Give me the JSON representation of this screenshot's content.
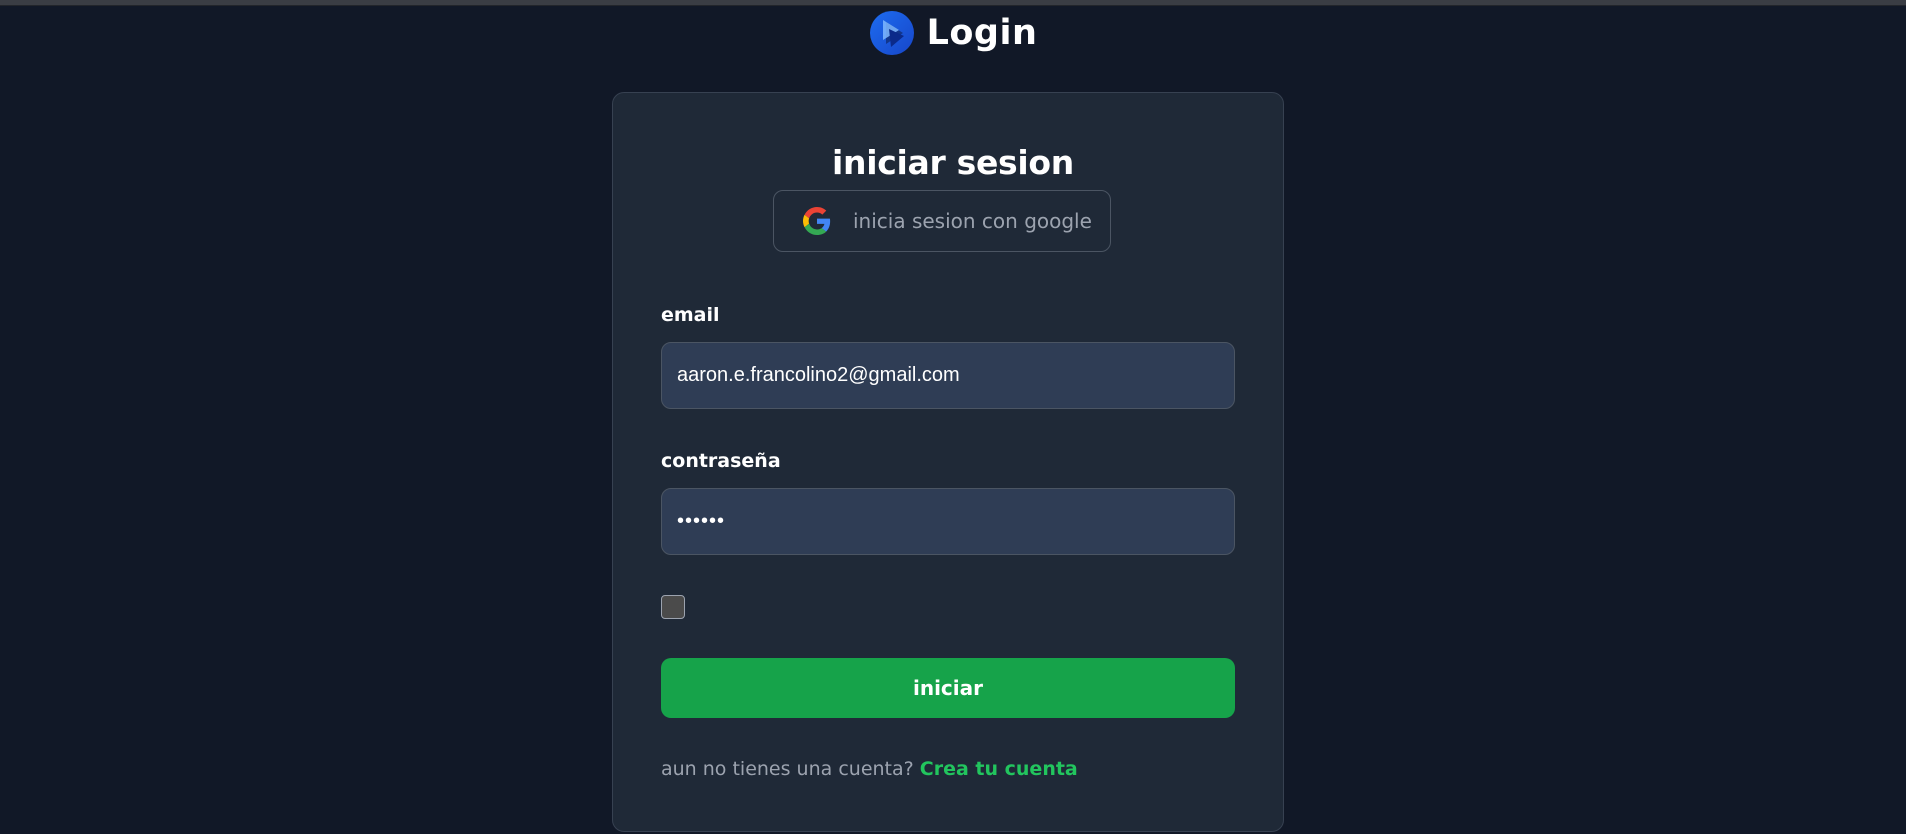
{
  "header": {
    "title": "Login",
    "logo_icon": "play-logo-icon"
  },
  "form": {
    "title": "iniciar sesion",
    "google_button_label": "inicia sesion con google",
    "google_icon": "google-g-icon",
    "email_label": "email",
    "email_value": "aaron.e.francolino2@gmail.com",
    "password_label": "contraseña",
    "password_value": "••••••",
    "remember_checked": false,
    "submit_label": "iniciar",
    "signup_prompt": "aun no tienes una cuenta?",
    "signup_link": "Crea tu cuenta"
  },
  "colors": {
    "background": "#111827",
    "card": "#1f2937",
    "input": "#2f3d55",
    "accent_green": "#16a34a",
    "link_green": "#22c55e"
  }
}
